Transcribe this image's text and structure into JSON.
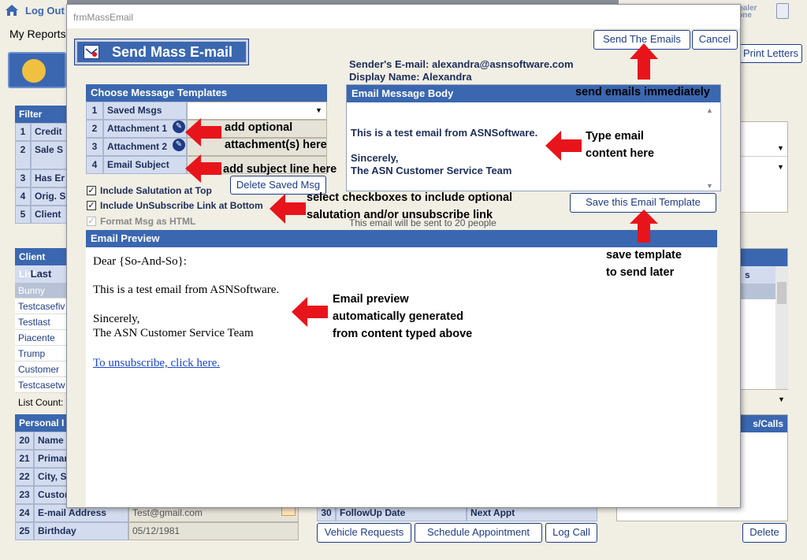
{
  "topbar": {
    "logout": "Log Out",
    "my_reports": "My Reports",
    "dealer_text": "Dealer\nZone"
  },
  "background": {
    "print_letters": "Print Letters",
    "filter_header": "Filter Clien",
    "filter_rows": [
      {
        "num": "1",
        "label": "Credit"
      },
      {
        "num": "2",
        "label": "Sale S"
      },
      {
        "num": "3",
        "label": "Has Er"
      },
      {
        "num": "4",
        "label": "Orig. S"
      },
      {
        "num": "5",
        "label": "Client"
      }
    ],
    "client_list_header": "Client List",
    "client_list_col": "Last",
    "client_list_col_right": "s",
    "clients": [
      "Bunny",
      "Testcasefiv",
      "Testlast",
      "Piacente",
      "Trump",
      "Customer",
      "Testcasetw"
    ],
    "list_count": "List Count:",
    "personal_header": "Personal I",
    "personal_rows": [
      {
        "num": "20",
        "label": "Name",
        "value": ""
      },
      {
        "num": "21",
        "label": "Primar",
        "value": ""
      },
      {
        "num": "22",
        "label": "City, S",
        "value": ""
      },
      {
        "num": "23",
        "label": "Custon",
        "value": ""
      },
      {
        "num": "24",
        "label": "E-mail Address",
        "value": "Test@gmail.com"
      },
      {
        "num": "25",
        "label": "Birthday",
        "value": "05/12/1981"
      }
    ],
    "followup": {
      "num": "30",
      "label": "FollowUp Date",
      "next": "Next Appt"
    },
    "calls_header": "s/Calls",
    "vehicle_requests": "Vehicle Requests",
    "schedule_appointment": "Schedule Appointment",
    "log_call": "Log Call",
    "delete": "Delete"
  },
  "dialog": {
    "window_title": "frmMassEmail",
    "title": "Send Mass E-mail",
    "send_button": "Send The Emails",
    "cancel_button": "Cancel",
    "sender_email": "Sender's E-mail: alexandra@asnsoftware.com",
    "display_name": "Display Name: Alexandra",
    "templates_header": "Choose Message Templates",
    "template_rows": [
      {
        "num": "1",
        "label": "Saved Msgs",
        "value": ""
      },
      {
        "num": "2",
        "label": "Attachment 1",
        "value": ""
      },
      {
        "num": "3",
        "label": "Attachment 2",
        "value": ""
      },
      {
        "num": "4",
        "label": "Email Subject",
        "value": ""
      }
    ],
    "delete_saved": "Delete Saved Msg",
    "checkboxes": [
      {
        "label": "Include Salutation at Top",
        "checked": true
      },
      {
        "label": "Include UnSubscribe Link at Bottom",
        "checked": true
      },
      {
        "label": "Format Msg as HTML",
        "checked": true
      }
    ],
    "body_header": "Email Message Body",
    "body_lines": [
      "This is a test email from ASNSoftware.",
      "",
      "Sincerely,",
      "The ASN Customer Service Team"
    ],
    "save_template": "Save this Email Template",
    "sent_to": "This email will be sent to 20 people",
    "preview_header": "Email Preview",
    "preview": {
      "salutation": "Dear {So-And-So}:",
      "line1": "This is a test email from ASNSoftware.",
      "line2": "Sincerely,",
      "line3": "The ASN Customer Service Team",
      "unsubscribe": "To unsubscribe, click here."
    }
  },
  "annotations": {
    "send_now": "send emails immediately",
    "attachments_1": "add optional",
    "attachments_2": "attachment(s) here",
    "subject": "add subject line here",
    "type_1": "Type email",
    "type_2": "content here",
    "checkboxes_1": "select checkboxes to include optional",
    "checkboxes_2": "salutation and/or unsubscribe link",
    "save_1": "save template",
    "save_2": "to send later",
    "preview_1": "Email preview",
    "preview_2": "automatically generated",
    "preview_3": "from content typed above"
  },
  "colors": {
    "header_blue": "#3a67b0",
    "arrow_red": "#e8141b",
    "dialog_bg": "#f1eee4"
  }
}
